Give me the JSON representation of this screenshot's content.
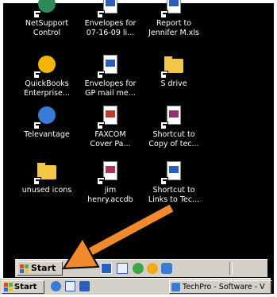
{
  "desktop": {
    "icons": [
      {
        "line1": "NetSupport",
        "line2": "Control",
        "icon": "netsupport-icon",
        "color": "#2e8b57"
      },
      {
        "line1": "Envelopes for",
        "line2": "07-16-09 li...",
        "icon": "word-document-icon",
        "color": "#2b5fbf"
      },
      {
        "line1": "Report to",
        "line2": "Jennifer M.xls",
        "icon": "excel-document-icon",
        "color": "#2b5fbf"
      },
      {
        "line1": "QuickBooks",
        "line2": "Enterprise...",
        "icon": "quickbooks-icon",
        "color": "#f2b705"
      },
      {
        "line1": "Envelopes for",
        "line2": "GP mail me...",
        "icon": "word-document-icon",
        "color": "#2b5fbf"
      },
      {
        "line1": "S drive",
        "line2": "",
        "icon": "folder-icon",
        "color": "#f2c744"
      },
      {
        "line1": "Televantage",
        "line2": "",
        "icon": "phone-icon",
        "color": "#3a7bd5"
      },
      {
        "line1": "FAXCOM",
        "line2": "Cover Pa...",
        "icon": "fax-document-icon",
        "color": "#c0392b"
      },
      {
        "line1": "Shortcut to",
        "line2": "Copy of tec...",
        "icon": "access-document-icon",
        "color": "#9b2d6f"
      },
      {
        "line1": "unused icons",
        "line2": "",
        "icon": "folder-icon",
        "color": "#f2c744"
      },
      {
        "line1": "jim",
        "line2": "henry.accdb",
        "icon": "access-database-icon",
        "color": "#b03060"
      },
      {
        "line1": "Shortcut to",
        "line2": "Links to Tec...",
        "icon": "word-document-icon",
        "color": "#2b5fbf"
      }
    ]
  },
  "taskbar_inner": {
    "start_label": "Start",
    "quicklaunch": [
      "show-desktop-icon",
      "internet-explorer-icon",
      "outlook-icon",
      "word-icon",
      "windows-media-icon",
      "ie-icon"
    ]
  },
  "taskbar_outer": {
    "start_label": "Start",
    "task_label": "TechPro - Software - V"
  },
  "colors": {
    "arrow": "#f08a2c",
    "taskbar": "#d4d0c8"
  }
}
